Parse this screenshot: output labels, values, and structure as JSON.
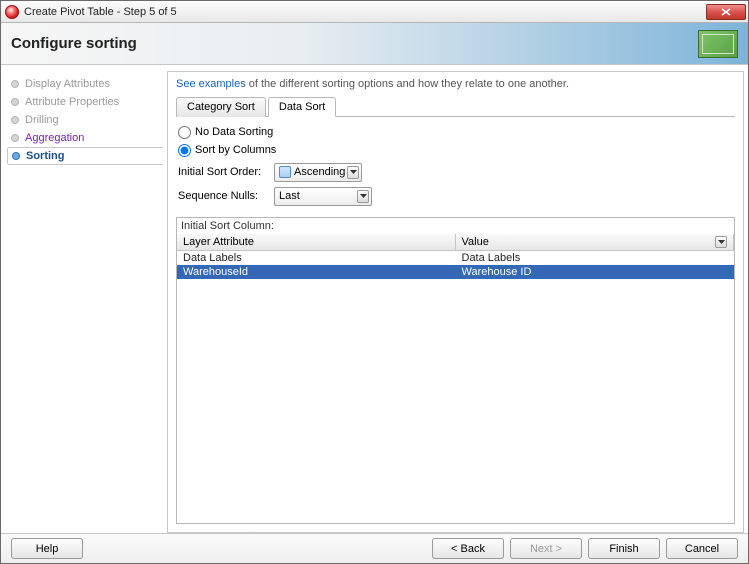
{
  "window": {
    "title": "Create Pivot Table - Step 5 of 5"
  },
  "banner": {
    "heading": "Configure sorting"
  },
  "sidebar": {
    "items": [
      {
        "label": "Display Attributes"
      },
      {
        "label": "Attribute Properties"
      },
      {
        "label": "Drilling"
      },
      {
        "label": "Aggregation"
      },
      {
        "label": "Sorting"
      }
    ]
  },
  "examples": {
    "link": "See examples",
    "rest": " of the different sorting options and how they relate to one another."
  },
  "tabs": {
    "category": "Category Sort",
    "data": "Data Sort"
  },
  "sortOptions": {
    "noSort": "No Data Sorting",
    "byColumns": "Sort by Columns",
    "initialOrderLabel": "Initial Sort Order:",
    "initialOrderValue": "Ascending",
    "seqNullsLabel": "Sequence Nulls:",
    "seqNullsValue": "Last"
  },
  "table": {
    "caption": "Initial Sort Column:",
    "headers": {
      "layer": "Layer Attribute",
      "value": "Value"
    },
    "rows": [
      {
        "layer": "Data Labels",
        "value": "Data Labels",
        "type": "group"
      },
      {
        "layer": "WarehouseId",
        "value": "Warehouse ID",
        "type": "selected"
      }
    ]
  },
  "footer": {
    "help": "Help",
    "back": "< Back",
    "next": "Next >",
    "finish": "Finish",
    "cancel": "Cancel"
  }
}
